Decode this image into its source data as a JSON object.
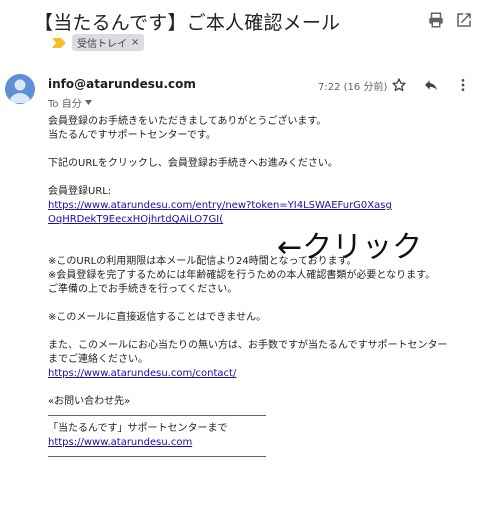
{
  "email": {
    "subject": "【当たるんです】ご本人確認メール",
    "label": "受信トレイ",
    "label_close": "×",
    "sender": "info@atarundesu.com",
    "to": "To 自分",
    "time": "7:22 (16 分前)",
    "body": {
      "l1": "会員登録のお手続きをいただきましてありがとうございます。",
      "l2": "当たるんですサポートセンターです。",
      "l3": "下記のURLをクリックし、会員登録お手続きへお進みください。",
      "l4": "会員登録URL:",
      "url1": "https://www.atarundesu.com/entry/new?token=YI4LSWAEFurG0Xasg",
      "url2": "OqHRDekT9EecxHOjhrtdQAiLO7GI(",
      "l5": "※このURLの利用期限は本メール配信より24時間となっております。",
      "l6": "※会員登録を完了するためには年齢確認を行うための本人確認書類が必要となります。",
      "l7": "ご準備の上でお手続きを行ってください。",
      "l8": "※このメールに直接返信することはできません。",
      "l9": "また、このメールにお心当たりの無い方は、お手数ですが当たるんですサポートセンター",
      "l10": "までご連絡ください。",
      "url3": "https://www.atarundesu.com/contact/",
      "l11": "«お問い合わせ先»",
      "l12": "「当たるんです」サポートセンターまで",
      "url4": "https://www.atarundesu.com"
    },
    "annotation": "←クリック"
  },
  "icons": {
    "print": "print-icon",
    "open_new": "open-in-new-icon",
    "label_arrow": "label-arrow-icon",
    "star": "star-icon",
    "reply": "reply-icon",
    "more": "more-vert-icon",
    "avatar": "avatar-icon"
  },
  "colors": {
    "link": "#1a0dab",
    "avatar": "#5f8fd4",
    "label_arrow": "#f6bf26"
  }
}
